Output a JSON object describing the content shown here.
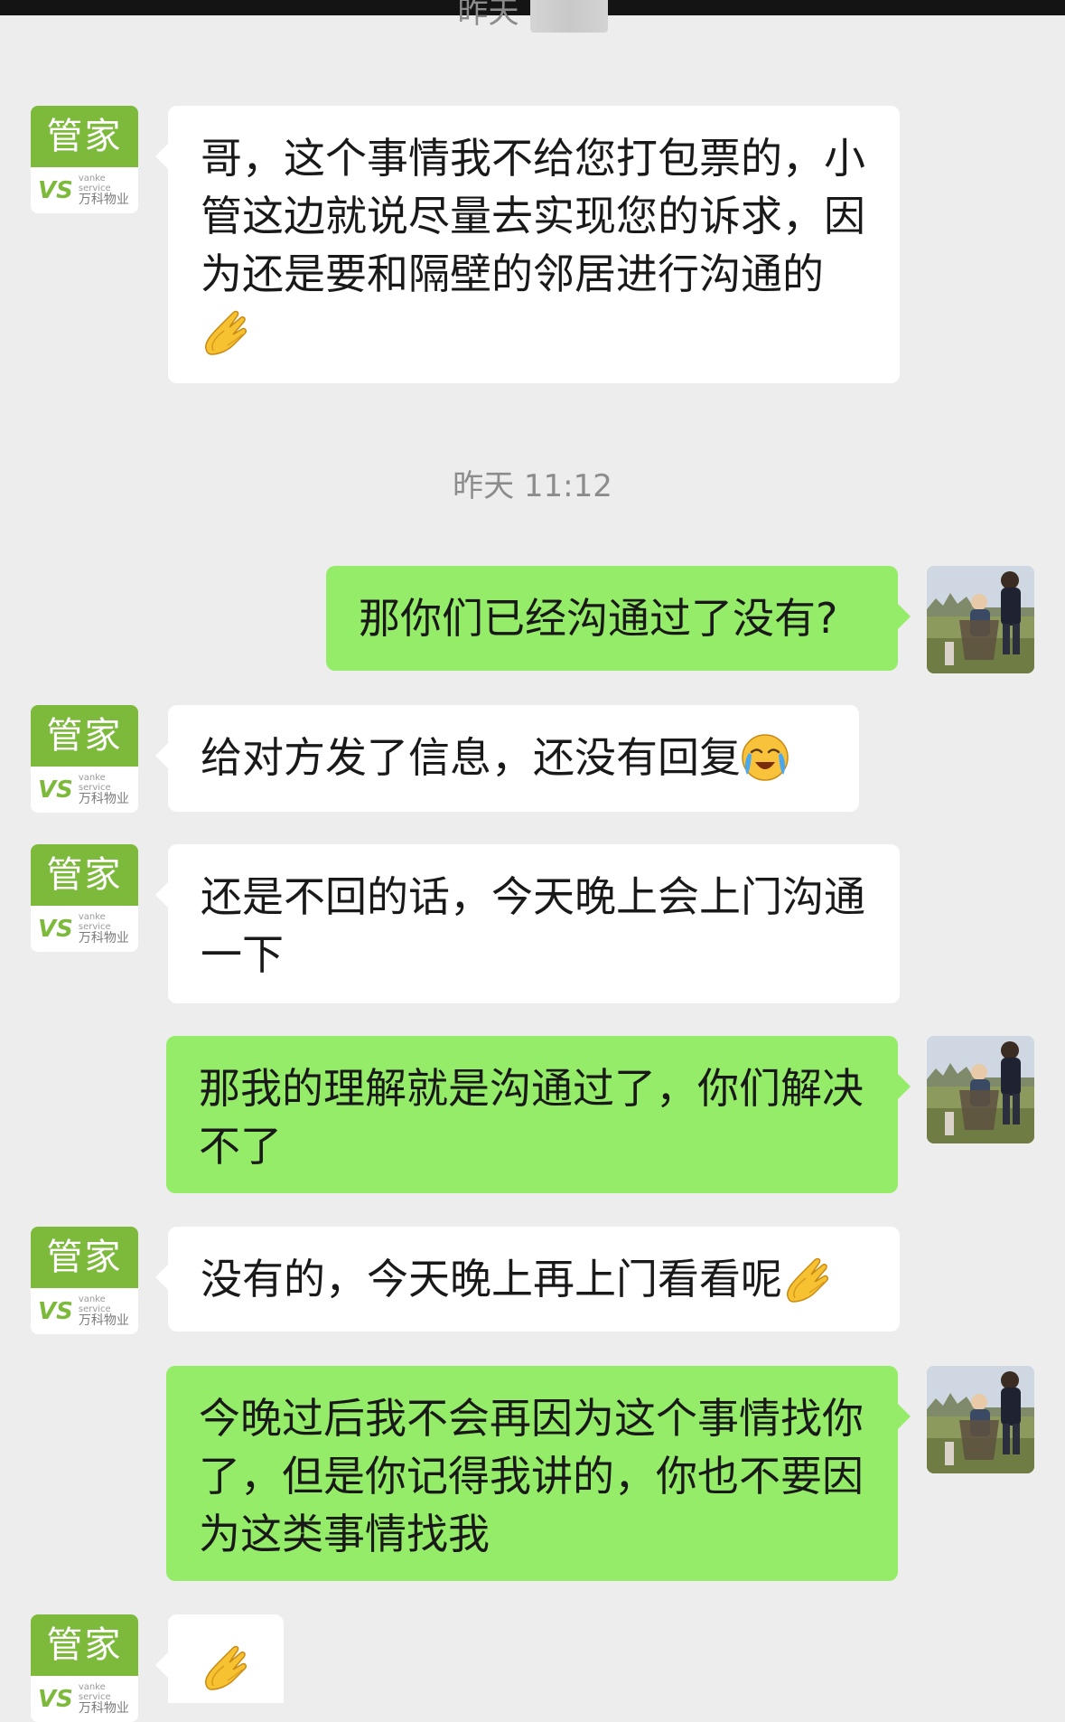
{
  "timestamps": {
    "top": "昨天",
    "middle": "昨天 11:12"
  },
  "butler_avatar": {
    "title": "管家",
    "logo": "VS",
    "brand_en": "vanke service",
    "brand_cn": "万科物业"
  },
  "messages": [
    {
      "sender": "butler",
      "text": "哥，这个事情我不给您打包票的，小管这边就说尽量去实现您的诉求，因为还是要和隔壁的邻居进行沟通的",
      "emoji": "folded-hands-icon"
    },
    {
      "sender": "me",
      "text": "那你们已经沟通过了没有?"
    },
    {
      "sender": "butler",
      "text": "给对方发了信息，还没有回复",
      "emoji": "crying-face-icon"
    },
    {
      "sender": "butler",
      "text": "还是不回的话，今天晚上会上门沟通一下"
    },
    {
      "sender": "me",
      "text": "那我的理解就是沟通过了，你们解决不了"
    },
    {
      "sender": "butler",
      "text": "没有的，今天晚上再上门看看呢",
      "emoji": "folded-hands-icon"
    },
    {
      "sender": "me",
      "text": "今晚过后我不会再因为这个事情找你了，但是你记得我讲的，你也不要因为这类事情找我"
    },
    {
      "sender": "butler",
      "text": "",
      "emoji": "folded-hands-icon"
    }
  ],
  "colors": {
    "background": "#ededed",
    "bubble_me": "#95ec69",
    "bubble_other": "#ffffff",
    "butler_green": "#7dba3c"
  }
}
